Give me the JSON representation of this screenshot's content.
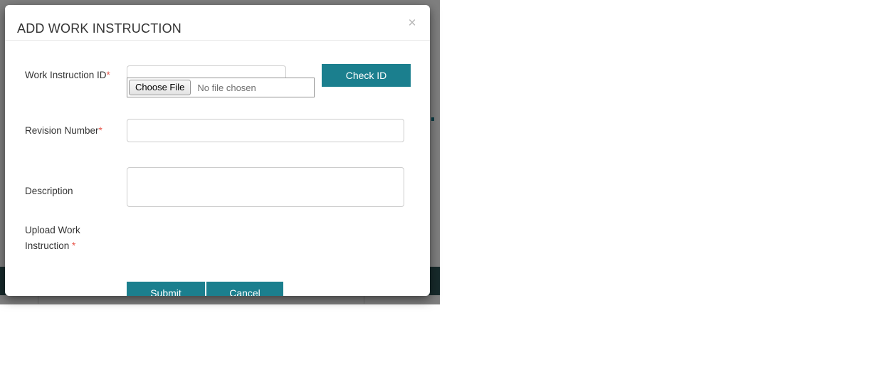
{
  "modal": {
    "title": "ADD WORK INSTRUCTION",
    "close_icon": "close-icon",
    "close_glyph": "×",
    "accent_color": "#1b7f8e",
    "required_marker_color": "#e8564a",
    "fields": {
      "work_instruction_id": {
        "label": "Work Instruction ID",
        "required_marker": "*",
        "value": "",
        "placeholder": ""
      },
      "revision_number": {
        "label": "Revision Number",
        "required_marker": "*",
        "value": "",
        "placeholder": ""
      },
      "description": {
        "label": "Description",
        "required_marker": "",
        "value": "",
        "placeholder": ""
      },
      "upload_work_instruction": {
        "label": "Upload Work Instruction ",
        "required_marker": "*",
        "button_label": "Choose File",
        "file_status": "No file chosen"
      }
    },
    "buttons": {
      "check_id": "Check ID",
      "submit": "Submit",
      "cancel": "Cancel"
    }
  },
  "background": {
    "overlay_color": "#808080",
    "teal_bar_color": "#2e5457"
  }
}
